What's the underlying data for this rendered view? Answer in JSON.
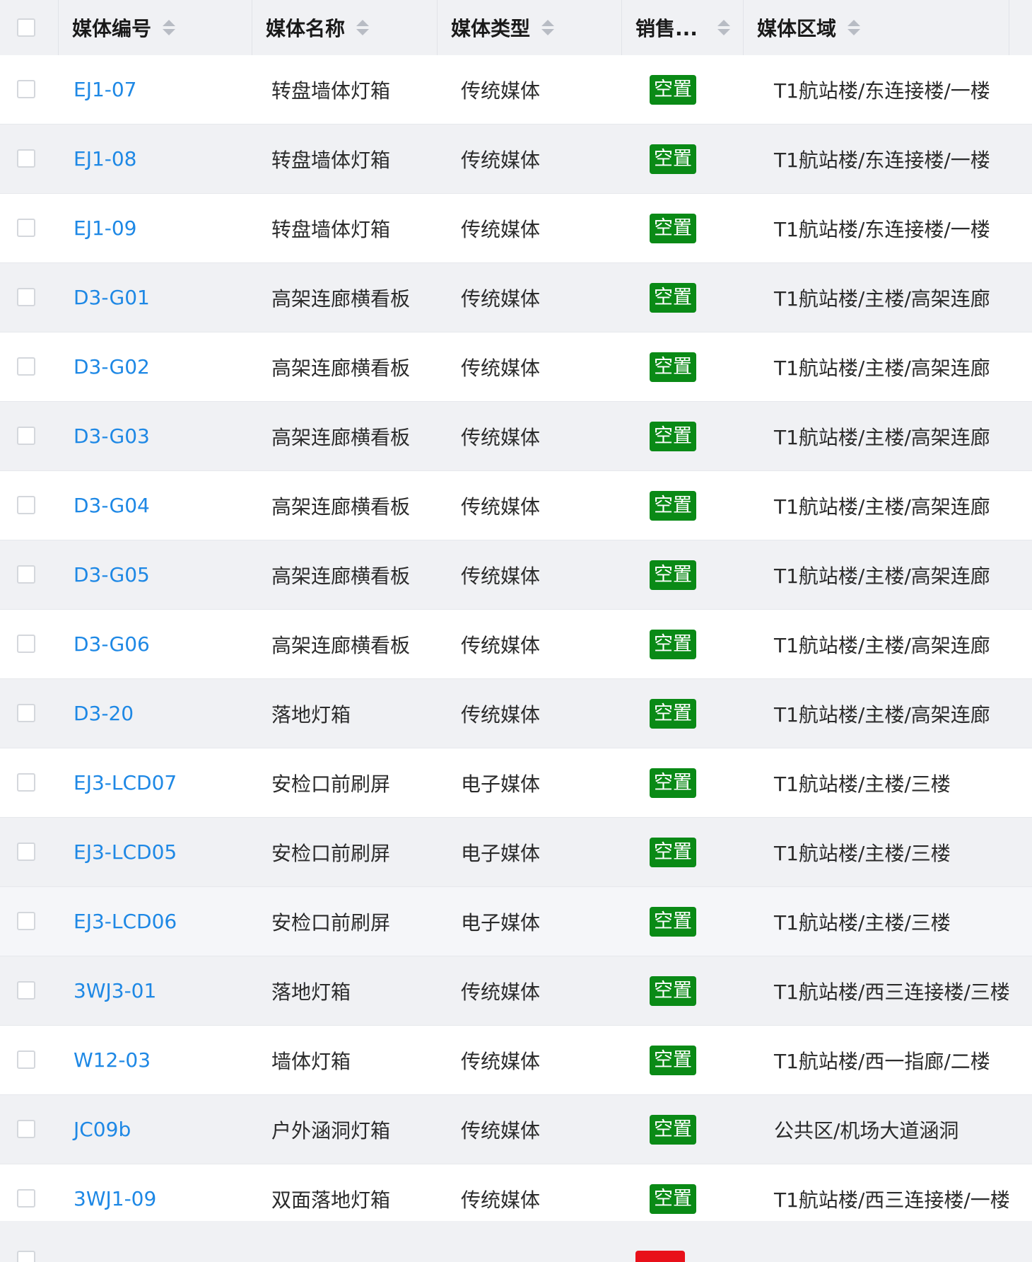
{
  "table": {
    "columns": [
      {
        "key": "select",
        "label": ""
      },
      {
        "key": "code",
        "label": "媒体编号"
      },
      {
        "key": "name",
        "label": "媒体名称"
      },
      {
        "key": "type",
        "label": "媒体类型"
      },
      {
        "key": "status",
        "label": "销售..."
      },
      {
        "key": "area",
        "label": "媒体区域"
      }
    ],
    "rows": [
      {
        "code": "EJ1-07",
        "name": "转盘墙体灯箱",
        "type": "传统媒体",
        "status": "空置",
        "area": "T1航站楼/东连接楼/一楼"
      },
      {
        "code": "EJ1-08",
        "name": "转盘墙体灯箱",
        "type": "传统媒体",
        "status": "空置",
        "area": "T1航站楼/东连接楼/一楼"
      },
      {
        "code": "EJ1-09",
        "name": "转盘墙体灯箱",
        "type": "传统媒体",
        "status": "空置",
        "area": "T1航站楼/东连接楼/一楼"
      },
      {
        "code": "D3-G01",
        "name": "高架连廊横看板",
        "type": "传统媒体",
        "status": "空置",
        "area": "T1航站楼/主楼/高架连廊"
      },
      {
        "code": "D3-G02",
        "name": "高架连廊横看板",
        "type": "传统媒体",
        "status": "空置",
        "area": "T1航站楼/主楼/高架连廊"
      },
      {
        "code": "D3-G03",
        "name": "高架连廊横看板",
        "type": "传统媒体",
        "status": "空置",
        "area": "T1航站楼/主楼/高架连廊"
      },
      {
        "code": "D3-G04",
        "name": "高架连廊横看板",
        "type": "传统媒体",
        "status": "空置",
        "area": "T1航站楼/主楼/高架连廊"
      },
      {
        "code": "D3-G05",
        "name": "高架连廊横看板",
        "type": "传统媒体",
        "status": "空置",
        "area": "T1航站楼/主楼/高架连廊"
      },
      {
        "code": "D3-G06",
        "name": "高架连廊横看板",
        "type": "传统媒体",
        "status": "空置",
        "area": "T1航站楼/主楼/高架连廊"
      },
      {
        "code": "D3-20",
        "name": "落地灯箱",
        "type": "传统媒体",
        "status": "空置",
        "area": "T1航站楼/主楼/高架连廊"
      },
      {
        "code": "EJ3-LCD07",
        "name": "安检口前刷屏",
        "type": "电子媒体",
        "status": "空置",
        "area": "T1航站楼/主楼/三楼"
      },
      {
        "code": "EJ3-LCD05",
        "name": "安检口前刷屏",
        "type": "电子媒体",
        "status": "空置",
        "area": "T1航站楼/主楼/三楼"
      },
      {
        "code": "EJ3-LCD06",
        "name": "安检口前刷屏",
        "type": "电子媒体",
        "status": "空置",
        "area": "T1航站楼/主楼/三楼"
      },
      {
        "code": "3WJ3-01",
        "name": "落地灯箱",
        "type": "传统媒体",
        "status": "空置",
        "area": "T1航站楼/西三连接楼/三楼"
      },
      {
        "code": "W12-03",
        "name": "墙体灯箱",
        "type": "传统媒体",
        "status": "空置",
        "area": "T1航站楼/西一指廊/二楼"
      },
      {
        "code": "JC09b",
        "name": "户外涵洞灯箱",
        "type": "传统媒体",
        "status": "空置",
        "area": "公共区/机场大道涵洞"
      },
      {
        "code": "3WJ1-09",
        "name": "双面落地灯箱",
        "type": "传统媒体",
        "status": "空置",
        "area": "T1航站楼/西三连接楼/一楼"
      }
    ],
    "colors": {
      "link": "#1e88e5",
      "status_vacant": "#0a8a16",
      "status_partial_row": "#e8101a",
      "header_bg": "#f0f1f4",
      "stripe_bg": "#f0f1f4"
    }
  }
}
